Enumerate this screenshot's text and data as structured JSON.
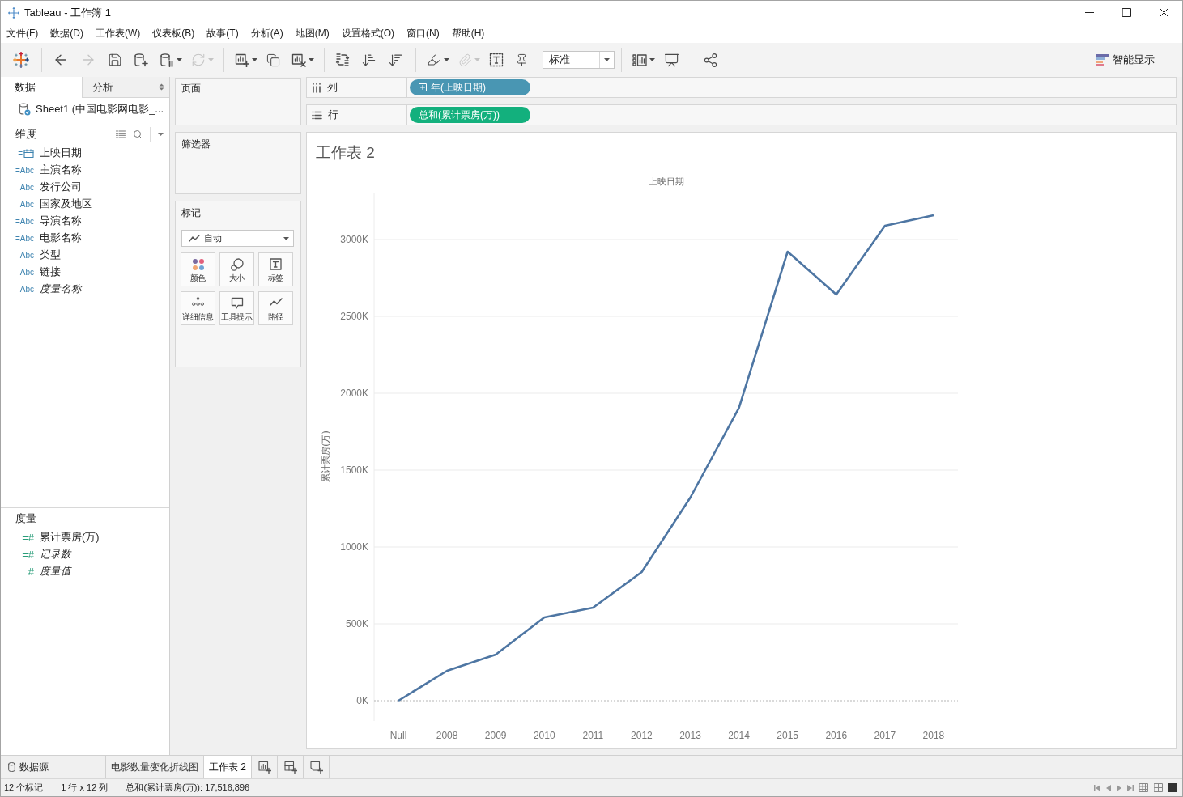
{
  "window": {
    "title": "Tableau - 工作簿 1"
  },
  "menu": [
    {
      "label": "文件(F)"
    },
    {
      "label": "数据(D)"
    },
    {
      "label": "工作表(W)"
    },
    {
      "label": "仪表板(B)"
    },
    {
      "label": "故事(T)"
    },
    {
      "label": "分析(A)"
    },
    {
      "label": "地图(M)"
    },
    {
      "label": "设置格式(O)"
    },
    {
      "label": "窗口(N)"
    },
    {
      "label": "帮助(H)"
    }
  ],
  "toolbar": {
    "groups": [
      {
        "items": [
          {
            "kind": "logo",
            "disabled": false,
            "menu": false
          }
        ]
      },
      {
        "items": [
          {
            "kind": "undo",
            "disabled": false,
            "menu": false
          },
          {
            "kind": "redo",
            "disabled": true,
            "menu": false
          },
          {
            "kind": "save",
            "disabled": false,
            "menu": false
          },
          {
            "kind": "add-source",
            "disabled": false,
            "menu": false
          },
          {
            "kind": "pause-updates",
            "disabled": false,
            "menu": true
          },
          {
            "kind": "refresh",
            "disabled": true,
            "menu": true
          }
        ]
      },
      {
        "items": [
          {
            "kind": "new-sheet",
            "disabled": false,
            "menu": true
          },
          {
            "kind": "duplicate",
            "disabled": false,
            "menu": false
          },
          {
            "kind": "clear",
            "disabled": false,
            "menu": true
          }
        ]
      },
      {
        "items": [
          {
            "kind": "swap",
            "disabled": false,
            "menu": false
          },
          {
            "kind": "sort-asc",
            "disabled": false,
            "menu": false
          },
          {
            "kind": "sort-desc",
            "disabled": false,
            "menu": false
          }
        ]
      },
      {
        "items": [
          {
            "kind": "highlight",
            "disabled": false,
            "menu": true
          },
          {
            "kind": "attach",
            "disabled": true,
            "menu": true
          },
          {
            "kind": "labels",
            "disabled": false,
            "menu": false
          },
          {
            "kind": "pin",
            "disabled": false,
            "menu": false
          }
        ],
        "dropdown": {
          "value": "标准"
        }
      },
      {
        "items": [
          {
            "kind": "cards",
            "disabled": false,
            "menu": true
          },
          {
            "kind": "present",
            "disabled": false,
            "menu": false
          }
        ]
      },
      {
        "items": [
          {
            "kind": "share",
            "disabled": false,
            "menu": false
          }
        ]
      }
    ],
    "show_me": {
      "label": "智能显示"
    }
  },
  "data_pane": {
    "tabs": [
      {
        "label": "数据",
        "selected": true
      },
      {
        "label": "分析",
        "selected": false
      }
    ],
    "source": {
      "name": "Sheet1 (中国电影网电影_..."
    },
    "dimensions": {
      "title": "维度",
      "fields": [
        {
          "name": "上映日期",
          "kind": "date",
          "tag": "=",
          "italic": false
        },
        {
          "name": "主演名称",
          "kind": "string",
          "tag": "=Abc",
          "italic": false
        },
        {
          "name": "发行公司",
          "kind": "string",
          "tag": "Abc",
          "italic": false
        },
        {
          "name": "国家及地区",
          "kind": "string",
          "tag": "Abc",
          "italic": false
        },
        {
          "name": "导演名称",
          "kind": "string",
          "tag": "=Abc",
          "italic": false
        },
        {
          "name": "电影名称",
          "kind": "string",
          "tag": "=Abc",
          "italic": false
        },
        {
          "name": "类型",
          "kind": "string",
          "tag": "Abc",
          "italic": false
        },
        {
          "name": "链接",
          "kind": "string",
          "tag": "Abc",
          "italic": false
        },
        {
          "name": "度量名称",
          "kind": "string",
          "tag": "Abc",
          "italic": true
        }
      ]
    },
    "measures": {
      "title": "度量",
      "fields": [
        {
          "name": "累计票房(万)",
          "kind": "number",
          "tag": "=#",
          "italic": false
        },
        {
          "name": "记录数",
          "kind": "number",
          "tag": "=#",
          "italic": true
        },
        {
          "name": "度量值",
          "kind": "number",
          "tag": "#",
          "italic": true
        }
      ]
    }
  },
  "cards": {
    "pages": {
      "title": "页面"
    },
    "filters": {
      "title": "筛选器"
    },
    "marks": {
      "title": "标记",
      "mark_type": {
        "label": "自动"
      },
      "buttons": [
        {
          "kind": "color",
          "label": "颜色"
        },
        {
          "kind": "size",
          "label": "大小"
        },
        {
          "kind": "label",
          "label": "标签"
        },
        {
          "kind": "detail",
          "label": "详细信息"
        },
        {
          "kind": "tooltip",
          "label": "工具提示"
        },
        {
          "kind": "path",
          "label": "路径"
        }
      ]
    }
  },
  "shelves": [
    {
      "kind": "columns",
      "label": "列",
      "pills": [
        {
          "label": "年(上映日期)",
          "kind": "discrete",
          "color": "#4996b3"
        }
      ]
    },
    {
      "kind": "rows",
      "label": "行",
      "pills": [
        {
          "label": "总和(累计票房(万))",
          "kind": "continuous",
          "color": "#13b07d"
        }
      ]
    }
  ],
  "view": {
    "title": "工作表 2",
    "chart_data": {
      "type": "line",
      "grid": true,
      "xlabel": "上映日期",
      "ylabel": "累计票房(万)",
      "categories": [
        "Null",
        "2008",
        "2009",
        "2010",
        "2011",
        "2012",
        "2013",
        "2014",
        "2015",
        "2016",
        "2017",
        "2018"
      ],
      "series": [
        {
          "color": "#4e76a3",
          "values": [
            0,
            195,
            300,
            542,
            605,
            837,
            1321,
            1905,
            2921,
            2642,
            3089,
            3158
          ]
        }
      ],
      "ylim": [
        0,
        3300
      ],
      "yticks": [
        {
          "value": 0,
          "label": "0K"
        },
        {
          "value": 500,
          "label": "500K"
        },
        {
          "value": 1000,
          "label": "1000K"
        },
        {
          "value": 1500,
          "label": "1500K"
        },
        {
          "value": 2000,
          "label": "2000K"
        },
        {
          "value": 2500,
          "label": "2500K"
        },
        {
          "value": 3000,
          "label": "3000K"
        }
      ]
    }
  },
  "sheet_tabs": {
    "data_source": {
      "label": "数据源"
    },
    "tabs": [
      {
        "label": "电影数量变化折线图",
        "selected": false
      },
      {
        "label": "工作表 2",
        "selected": true
      }
    ]
  },
  "status_bar": {
    "marks": "12 个标记",
    "layout": "1 行 x 12 列",
    "sum": "总和(累计票房(万)): 17,516,896"
  }
}
